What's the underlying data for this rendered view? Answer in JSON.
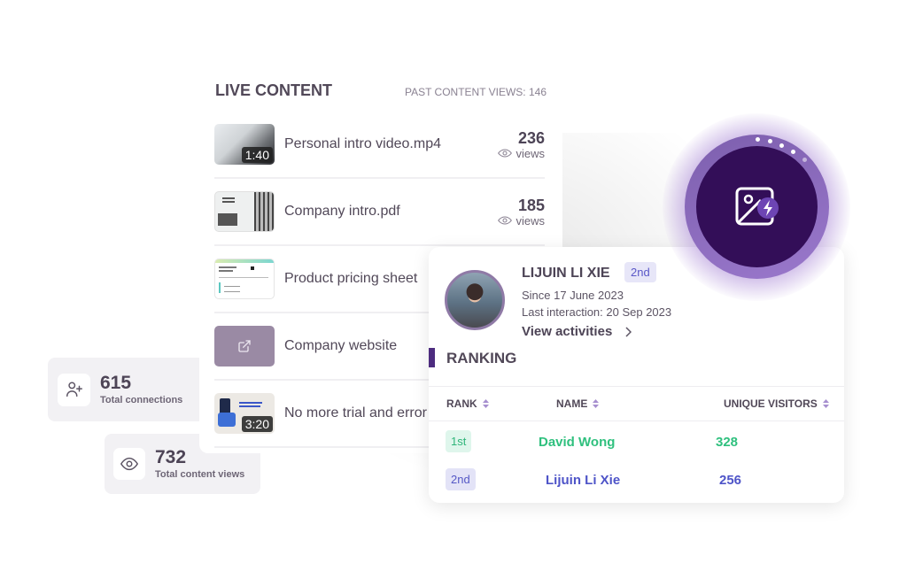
{
  "live_content": {
    "title": "LIVE CONTENT",
    "past_views": "PAST CONTENT VIEWS: 146",
    "items": [
      {
        "name": "Personal intro video.mp4",
        "duration": "1:40",
        "views": "236",
        "views_label": "views",
        "thumb": "video-thumbnail"
      },
      {
        "name": "Company intro.pdf",
        "views": "185",
        "views_label": "views",
        "thumb": "pdf-thumbnail"
      },
      {
        "name": "Product pricing sheet",
        "thumb": "sheet-thumbnail"
      },
      {
        "name": "Company website",
        "thumb": "external-link-icon"
      },
      {
        "name": "No more trial and error",
        "duration": "3:20",
        "thumb": "video-thumbnail"
      }
    ]
  },
  "stats": {
    "connections": {
      "value": "615",
      "label": "Total connections",
      "icon": "user-plus-icon"
    },
    "content_views": {
      "value": "732",
      "label": "Total content views",
      "icon": "eye-icon"
    }
  },
  "profile": {
    "name": "LIJUIN LI XIE",
    "rank_badge": "2nd",
    "since": "Since 17 June 2023",
    "last_interaction": "Last interaction: 20 Sep 2023",
    "view_activities": "View activities",
    "ranking_title": "RANKING",
    "columns": [
      "RANK",
      "NAME",
      "UNIQUE VISITORS"
    ],
    "rows": [
      {
        "rank": "1st",
        "name": "David Wong",
        "visitors": "328",
        "color": "#2fc07e"
      },
      {
        "rank": "2nd",
        "name": "Lijuin Li Xie",
        "visitors": "256",
        "color": "#4e54c8"
      }
    ]
  },
  "ai_badge": {
    "icon": "image-ai-icon",
    "accent": "#330e58"
  }
}
